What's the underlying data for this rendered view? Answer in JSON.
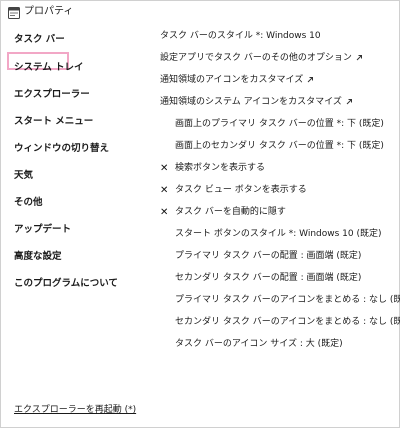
{
  "window": {
    "title": "プロパティ",
    "app_icon": "window-properties-icon"
  },
  "sidebar": {
    "items": [
      {
        "label": "タスク バー",
        "selected": true
      },
      {
        "label": "システム トレイ"
      },
      {
        "label": "エクスプローラー"
      },
      {
        "label": "スタート メニュー"
      },
      {
        "label": "ウィンドウの切り替え"
      },
      {
        "label": "天気"
      },
      {
        "label": "その他"
      },
      {
        "label": "アップデート"
      },
      {
        "label": "高度な設定"
      },
      {
        "label": "このプログラムについて"
      }
    ],
    "restart_link": "エクスプローラーを再起動 (*)"
  },
  "main": {
    "options": [
      {
        "text": "タスク バーのスタイル *: Windows 10"
      },
      {
        "text": "設定アプリでタスク バーのその他のオプション",
        "icon": "external-link-icon"
      },
      {
        "text": "通知領域のアイコンをカスタマイズ",
        "icon": "external-link-icon"
      },
      {
        "text": "通知領域のシステム アイコンをカスタマイズ",
        "icon": "external-link-icon"
      },
      {
        "text": "画面上のプライマリ タスク バーの位置 *: 下 (既定)"
      },
      {
        "text": "画面上のセカンダリ タスク バーの位置 *: 下 (既定)"
      },
      {
        "text": "検索ボタンを表示する",
        "checked": true
      },
      {
        "text": "タスク ビュー ボタンを表示する",
        "checked": true
      },
      {
        "text": "タスク バーを自動的に隠す",
        "checked": true
      },
      {
        "text": "スタート ボタンのスタイル *: Windows 10 (既定)"
      },
      {
        "text": "プライマリ タスク バーの配置 : 画面端 (既定)"
      },
      {
        "text": "セカンダリ タスク バーの配置 : 画面端 (既定)"
      },
      {
        "text": "プライマリ タスク バーのアイコンをまとめる : なし (既定)"
      },
      {
        "text": "セカンダリ タスク バーのアイコンをまとめる : なし (既定)"
      },
      {
        "text": "タスク バーのアイコン サイズ : 大 (既定)"
      }
    ],
    "checkmark_glyph": "✕"
  },
  "colors": {
    "selected_border": "#f2a7c6",
    "text": "#1a1a1a",
    "background": "#ffffff"
  }
}
